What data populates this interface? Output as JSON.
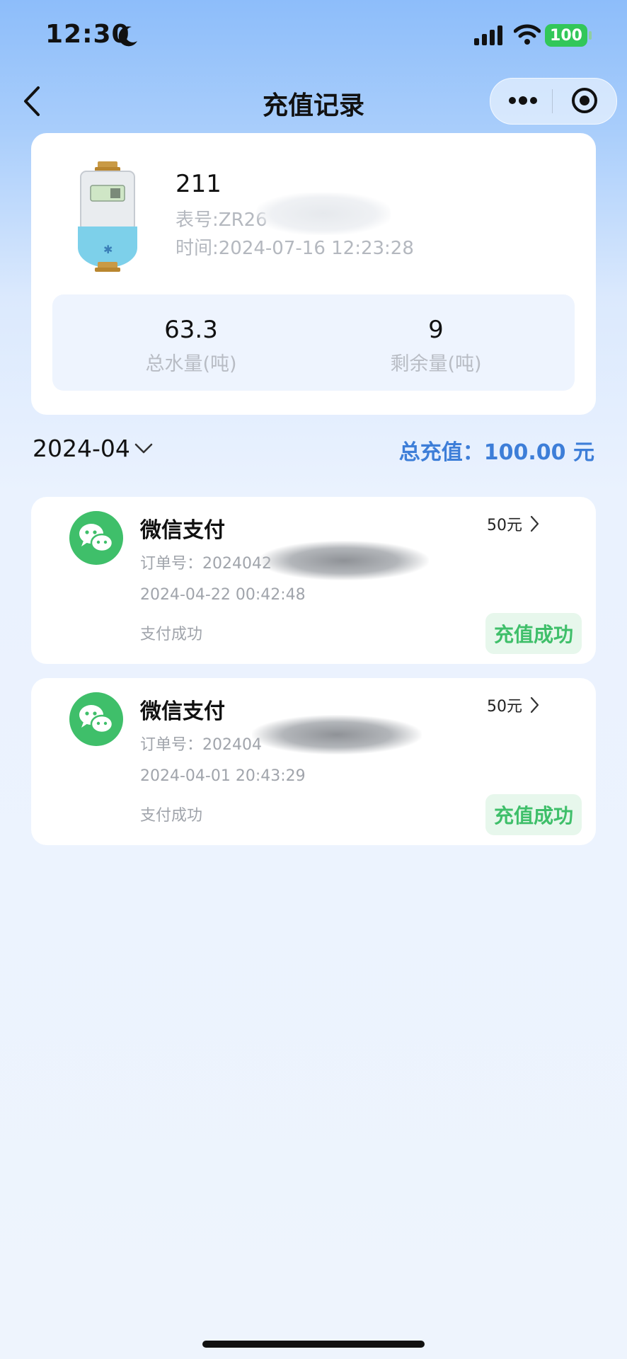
{
  "status_bar": {
    "time": "12:30",
    "battery": "100"
  },
  "nav": {
    "title": "充值记录"
  },
  "device": {
    "name": "211",
    "meter_no": "表号:ZR26",
    "time": "时间:2024-07-16 12:23:28",
    "stats": [
      {
        "value": "63.3",
        "label": "总水量(吨)"
      },
      {
        "value": "9",
        "label": "剩余量(吨)"
      }
    ]
  },
  "filter": {
    "month": "2024-04",
    "total": "总充值：100.00 元"
  },
  "records": [
    {
      "method": "微信支付",
      "amount": "50元",
      "order": "订单号：2024042",
      "date": "2024-04-22 00:42:48",
      "pay_status": "支付成功",
      "recharge_status": "充值成功"
    },
    {
      "method": "微信支付",
      "amount": "50元",
      "order": "订单号：202404",
      "date": "2024-04-01 20:43:29",
      "pay_status": "支付成功",
      "recharge_status": "充值成功"
    }
  ],
  "colors": {
    "accent": "#3d7ed8",
    "success": "#3fbf6a",
    "wechat": "#3fbf6a"
  }
}
